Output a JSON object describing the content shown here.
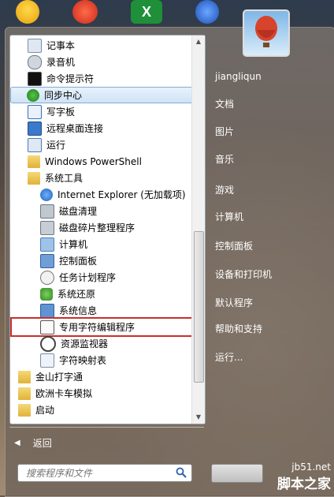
{
  "desktop_icons": [
    "qq-icon",
    "ie-icon",
    "excel-icon",
    "app-icon"
  ],
  "excel_letter": "X",
  "programs": [
    {
      "label": "记事本",
      "icon": "notepad-icon",
      "level": 1
    },
    {
      "label": "录音机",
      "icon": "microphone-icon",
      "level": 1
    },
    {
      "label": "命令提示符",
      "icon": "cmd-icon",
      "level": 1
    },
    {
      "label": "同步中心",
      "icon": "sync-icon",
      "level": 1,
      "highlighted": true
    },
    {
      "label": "写字板",
      "icon": "wordpad-icon",
      "level": 1
    },
    {
      "label": "远程桌面连接",
      "icon": "remote-desktop-icon",
      "level": 1
    },
    {
      "label": "运行",
      "icon": "run-icon",
      "level": 1
    },
    {
      "label": "Windows PowerShell",
      "icon": "folder-icon",
      "level": 1
    },
    {
      "label": "系统工具",
      "icon": "folder-icon",
      "level": 1
    },
    {
      "label": "Internet Explorer (无加载项)",
      "icon": "ie-icon",
      "level": 2
    },
    {
      "label": "磁盘清理",
      "icon": "disk-cleanup-icon",
      "level": 2
    },
    {
      "label": "磁盘碎片整理程序",
      "icon": "defrag-icon",
      "level": 2
    },
    {
      "label": "计算机",
      "icon": "computer-icon",
      "level": 2
    },
    {
      "label": "控制面板",
      "icon": "control-panel-icon",
      "level": 2
    },
    {
      "label": "任务计划程序",
      "icon": "clock-icon",
      "level": 2
    },
    {
      "label": "系统还原",
      "icon": "system-restore-icon",
      "level": 2
    },
    {
      "label": "系统信息",
      "icon": "system-info-icon",
      "level": 2
    },
    {
      "label": "专用字符编辑程序",
      "icon": "private-char-editor-icon",
      "level": 2,
      "boxed": true
    },
    {
      "label": "资源监视器",
      "icon": "resource-monitor-icon",
      "level": 2
    },
    {
      "label": "字符映射表",
      "icon": "char-map-icon",
      "level": 2
    },
    {
      "label": "金山打字通",
      "icon": "folder-icon",
      "level": 0
    },
    {
      "label": "欧洲卡车模拟",
      "icon": "folder-icon",
      "level": 0
    },
    {
      "label": "启动",
      "icon": "folder-icon",
      "level": 0
    }
  ],
  "back_label": "返回",
  "search": {
    "placeholder": "搜索程序和文件"
  },
  "right_items": [
    "jiangliqun",
    "文档",
    "图片",
    "音乐",
    "游戏",
    "计算机",
    "控制面板",
    "设备和打印机",
    "默认程序",
    "帮助和支持",
    "运行..."
  ],
  "watermark": {
    "site": "jb51.net",
    "name": "脚本之家"
  },
  "colors": {
    "highlight_border": "#84acd5",
    "callout_box": "#c8302c",
    "folder": "#e8c04a"
  }
}
